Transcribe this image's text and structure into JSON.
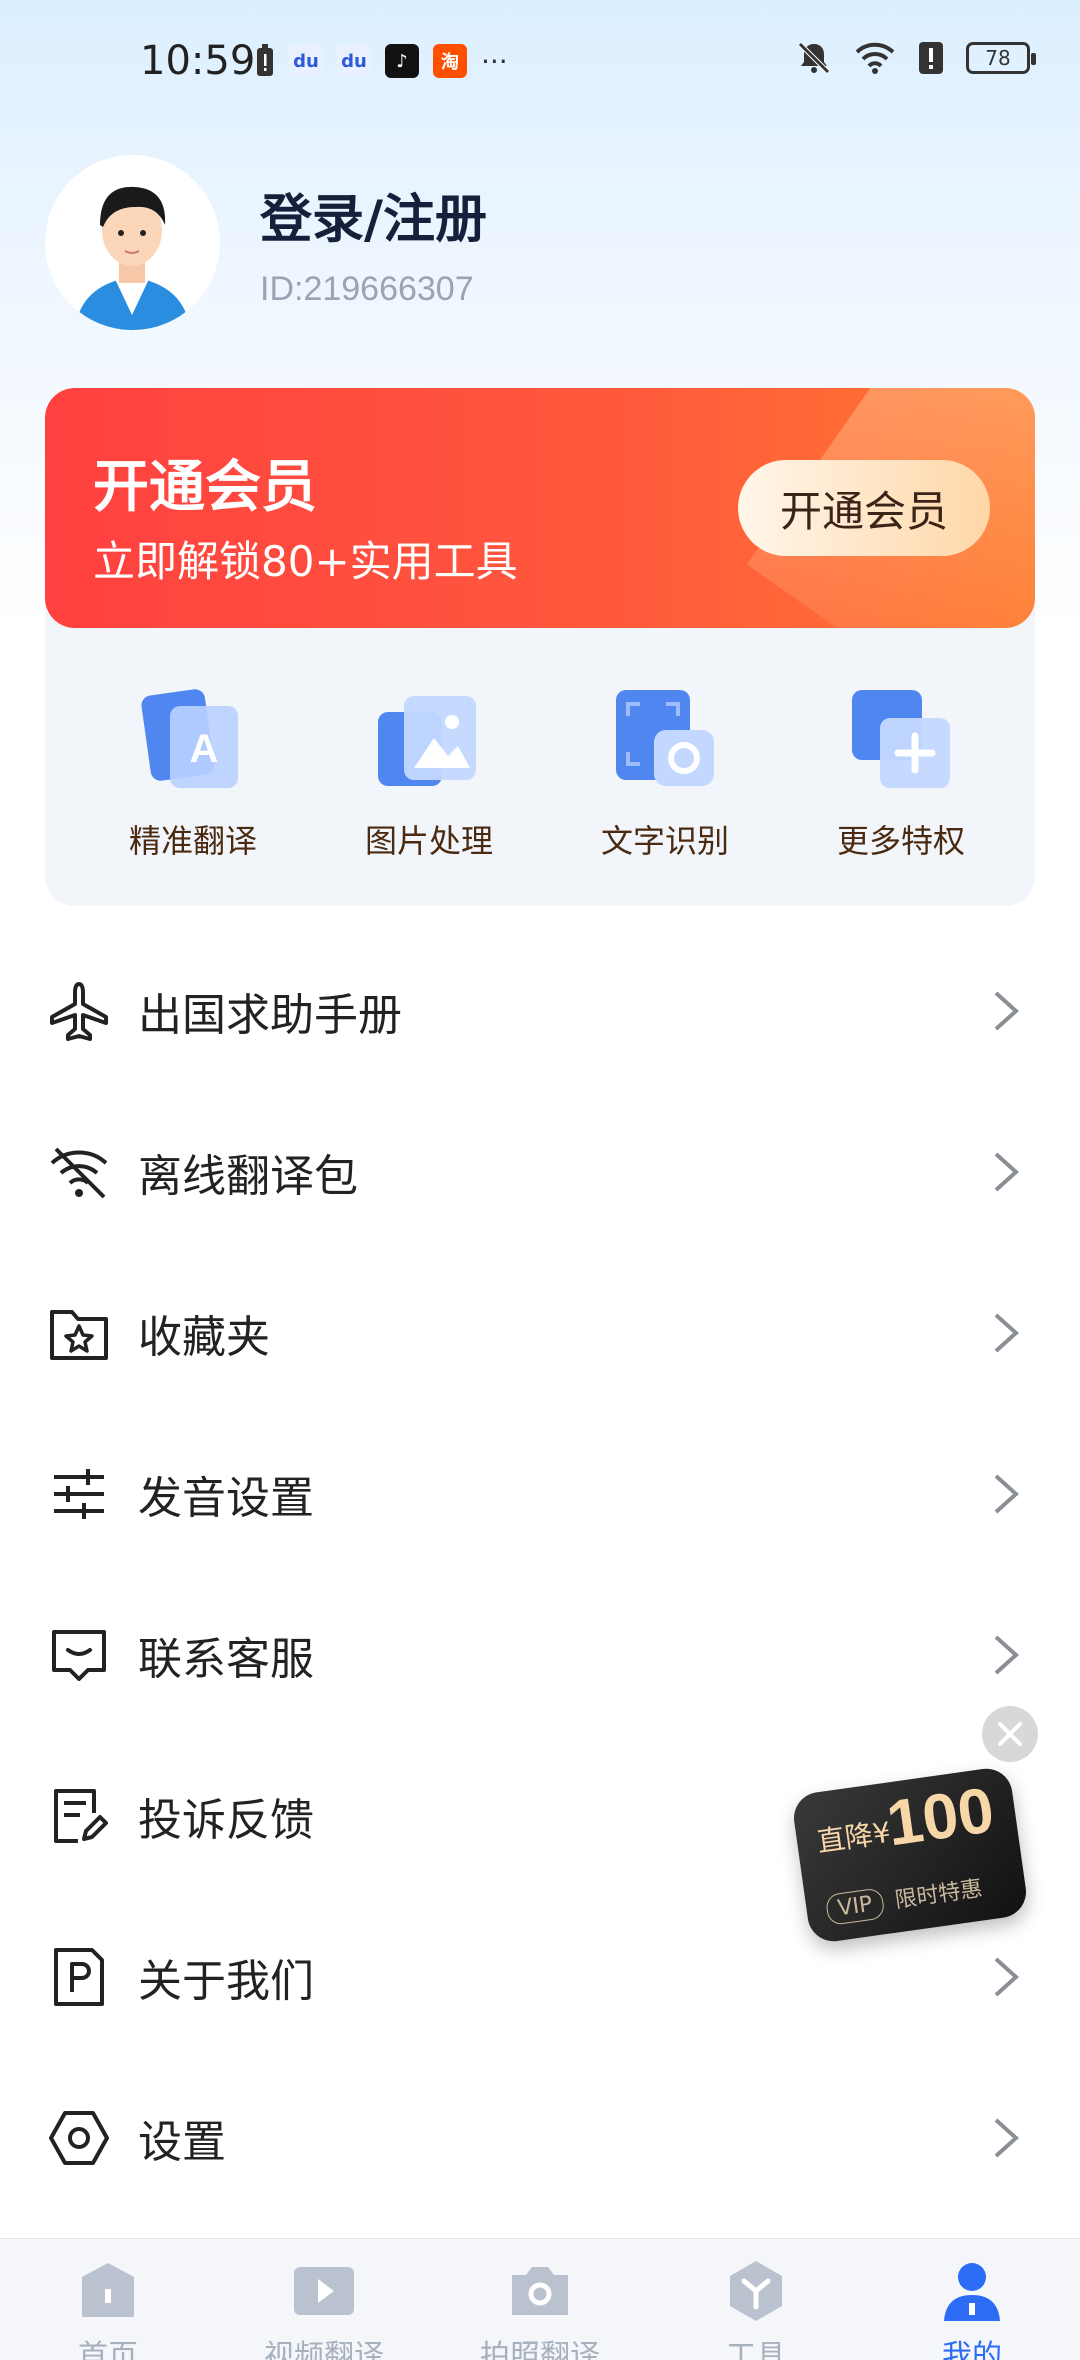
{
  "status": {
    "time": "10:59",
    "battery": "78",
    "notif_more": "···"
  },
  "profile": {
    "username": "登录/注册",
    "user_id": "ID:219666307"
  },
  "member": {
    "title": "开通会员",
    "subtitle": "立即解锁80+实用工具",
    "button": "开通会员",
    "perks": [
      {
        "label": "精准翻译",
        "icon": "translate-card-icon"
      },
      {
        "label": "图片处理",
        "icon": "image-card-icon"
      },
      {
        "label": "文字识别",
        "icon": "ocr-camera-icon"
      },
      {
        "label": "更多特权",
        "icon": "plus-card-icon"
      }
    ]
  },
  "menu": [
    {
      "label": "出国求助手册",
      "icon": "airplane-icon"
    },
    {
      "label": "离线翻译包",
      "icon": "wifi-off-icon"
    },
    {
      "label": "收藏夹",
      "icon": "star-folder-icon"
    },
    {
      "label": "发音设置",
      "icon": "sliders-icon"
    },
    {
      "label": "联系客服",
      "icon": "chat-icon"
    },
    {
      "label": "投诉反馈",
      "icon": "feedback-icon"
    },
    {
      "label": "关于我们",
      "icon": "about-icon"
    },
    {
      "label": "设置",
      "icon": "settings-hexagon-icon"
    }
  ],
  "promo": {
    "prefix": "直降¥",
    "amount": "100",
    "vip": "VIP",
    "note": "限时特惠"
  },
  "tabs": [
    {
      "label": "首页",
      "icon": "home-icon"
    },
    {
      "label": "视频翻译",
      "icon": "video-icon"
    },
    {
      "label": "拍照翻译",
      "icon": "camera-icon"
    },
    {
      "label": "工具",
      "icon": "tools-icon"
    },
    {
      "label": "我的",
      "icon": "profile-icon",
      "active": true
    }
  ],
  "colors": {
    "accent": "#2d6cf5",
    "banner_red": "#ff4a3c",
    "perk_text": "#4a2a10"
  }
}
